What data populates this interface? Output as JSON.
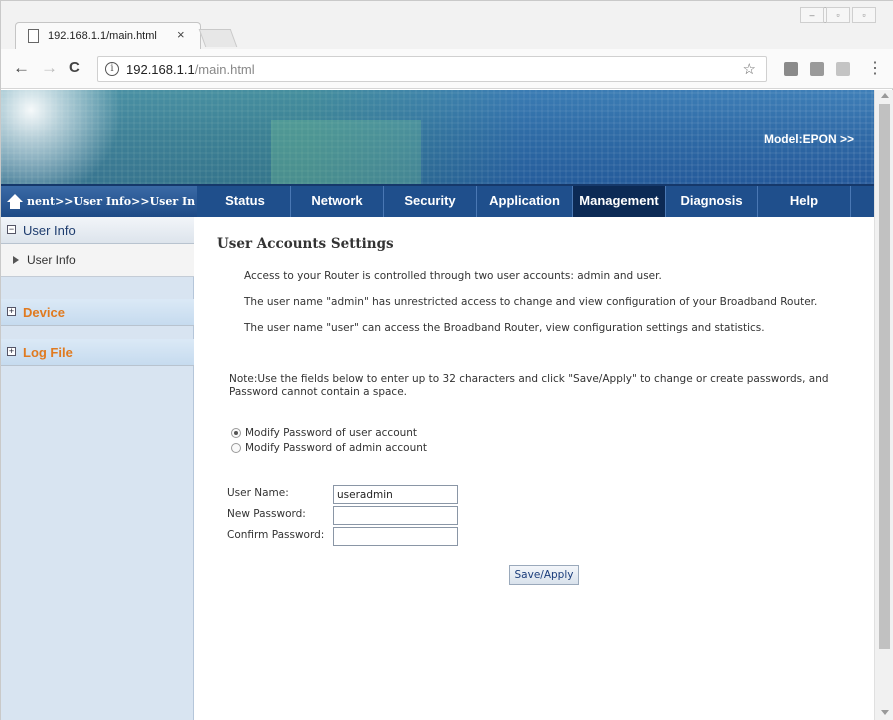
{
  "browser": {
    "tab_title": "192.168.1.1/main.html",
    "tab_close": "×",
    "url_host": "192.168.1.1",
    "url_path": "/main.html",
    "info_glyph": "i",
    "back_glyph": "←",
    "forward_glyph": "→",
    "reload_glyph": "C",
    "star_glyph": "☆",
    "menu_glyph": "⋮",
    "window_buttons": [
      "–",
      "▫",
      "▫"
    ]
  },
  "banner": {
    "model_text": "Model:EPON  >>"
  },
  "breadcrumb": {
    "text": "nent>>User Info>>User In"
  },
  "menu": {
    "tabs": [
      {
        "label": "Status"
      },
      {
        "label": "Network"
      },
      {
        "label": "Security"
      },
      {
        "label": "Application"
      },
      {
        "label": "Management"
      },
      {
        "label": "Diagnosis"
      },
      {
        "label": "Help"
      }
    ],
    "active": "Management"
  },
  "sidebar": {
    "groups": [
      {
        "label": "User Info",
        "toggle": "−",
        "expanded": true,
        "items": [
          {
            "label": "User Info"
          }
        ]
      },
      {
        "label": "Device",
        "toggle": "+",
        "expanded": false
      },
      {
        "label": "Log File",
        "toggle": "+",
        "expanded": false
      }
    ]
  },
  "content": {
    "heading": "User Accounts Settings",
    "paragraphs": [
      "Access to your Router is controlled through two user accounts: admin and user.",
      "The user name \"admin\" has unrestricted access to change and view configuration of your Broadband Router.",
      "The user name \"user\" can access the Broadband Router, view configuration settings and statistics."
    ],
    "note": "Note:Use the fields below to enter up to 32 characters and click \"Save/Apply\" to change or create passwords, and Password cannot contain a space.",
    "radios": [
      {
        "label": "Modify Password of user account",
        "checked": true
      },
      {
        "label": "Modify Password of admin account",
        "checked": false
      }
    ],
    "fields": {
      "user_name_label": "User Name:",
      "user_name_value": "useradmin",
      "new_password_label": "New Password:",
      "new_password_value": "",
      "confirm_password_label": "Confirm Password:",
      "confirm_password_value": ""
    },
    "save_button": "Save/Apply"
  },
  "colors": {
    "menu_bar": "#1f4f8c",
    "menu_active": "#0c2a55",
    "sidebar_bg": "#d8e4f1",
    "collapsed_group_text": "#e07a1f"
  }
}
